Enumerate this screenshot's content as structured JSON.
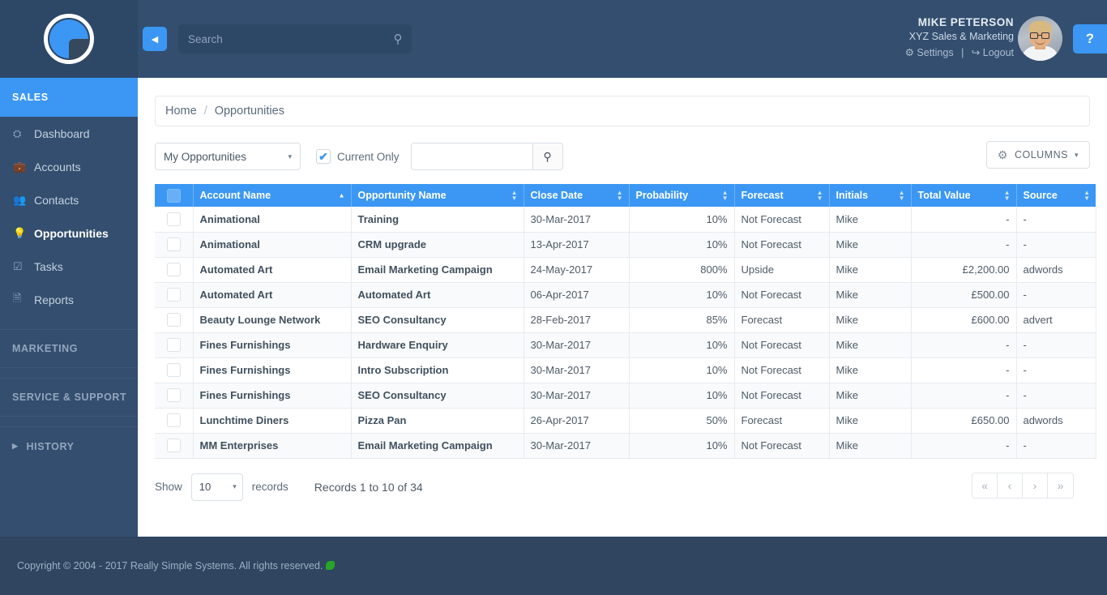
{
  "brand": {
    "accent": "#3b97f3",
    "header_bg": "#334e6f",
    "sidebar_bg": "#334e6f",
    "footer_bg": "#2f4560"
  },
  "sidebar": {
    "groups": [
      {
        "label": "SALES",
        "active": true
      },
      {
        "label": "MARKETING",
        "active": false
      },
      {
        "label": "SERVICE & SUPPORT",
        "active": false
      },
      {
        "label": "HISTORY",
        "active": false
      }
    ],
    "items": [
      {
        "label": "Dashboard",
        "icon": "dashboard-icon",
        "glyph": "⛭",
        "current": false
      },
      {
        "label": "Accounts",
        "icon": "briefcase-icon",
        "glyph": "💼",
        "current": false
      },
      {
        "label": "Contacts",
        "icon": "people-icon",
        "glyph": "👥",
        "current": false
      },
      {
        "label": "Opportunities",
        "icon": "lightbulb-icon",
        "glyph": "💡",
        "current": true
      },
      {
        "label": "Tasks",
        "icon": "check-square-icon",
        "glyph": "☑",
        "current": false
      },
      {
        "label": "Reports",
        "icon": "file-copy-icon",
        "glyph": "🗎",
        "current": false
      }
    ]
  },
  "topbar": {
    "collapse_glyph": "◀",
    "search": {
      "placeholder": "Search",
      "value": "",
      "icon": "search-icon",
      "glyph": "⚲"
    },
    "user": {
      "name": "MIKE PETERSON",
      "company": "XYZ Sales & Marketing",
      "settings_label": "Settings",
      "settings_glyph": "⚙",
      "separator": "|",
      "logout_label": "Logout",
      "logout_glyph": "↪"
    },
    "help_label": "?"
  },
  "breadcrumb": {
    "home": "Home",
    "separator": "/",
    "current": "Opportunities"
  },
  "toolbar": {
    "view_select": {
      "value": "My Opportunities",
      "caret": "▾"
    },
    "current_only": {
      "label": "Current Only",
      "checked": true,
      "check_glyph": "✔"
    },
    "filter_input": {
      "value": "",
      "placeholder": ""
    },
    "filter_button_glyph": "⚲",
    "columns_button": {
      "label": "COLUMNS",
      "gear_glyph": "⚙",
      "caret": "▾"
    }
  },
  "table": {
    "columns": [
      {
        "key": "select",
        "label": "",
        "sort": "none"
      },
      {
        "key": "account",
        "label": "Account Name",
        "sort": "asc"
      },
      {
        "key": "opportunity",
        "label": "Opportunity Name",
        "sort": "both"
      },
      {
        "key": "close_date",
        "label": "Close Date",
        "sort": "both"
      },
      {
        "key": "probability",
        "label": "Probability",
        "sort": "both"
      },
      {
        "key": "forecast",
        "label": "Forecast",
        "sort": "both"
      },
      {
        "key": "initials",
        "label": "Initials",
        "sort": "both"
      },
      {
        "key": "total_value",
        "label": "Total Value",
        "sort": "both"
      },
      {
        "key": "source",
        "label": "Source",
        "sort": "both"
      }
    ],
    "rows": [
      {
        "account": "Animational",
        "opportunity": "Training",
        "close_date": "30-Mar-2017",
        "probability": "10%",
        "forecast": "Not Forecast",
        "initials": "Mike",
        "total_value": "-",
        "source": "-"
      },
      {
        "account": "Animational",
        "opportunity": "CRM upgrade",
        "close_date": "13-Apr-2017",
        "probability": "10%",
        "forecast": "Not Forecast",
        "initials": "Mike",
        "total_value": "-",
        "source": "-"
      },
      {
        "account": "Automated Art",
        "opportunity": "Email Marketing Campaign",
        "close_date": "24-May-2017",
        "probability": "800%",
        "forecast": "Upside",
        "initials": "Mike",
        "total_value": "£2,200.00",
        "source": "adwords"
      },
      {
        "account": "Automated Art",
        "opportunity": "Automated Art",
        "close_date": "06-Apr-2017",
        "probability": "10%",
        "forecast": "Not Forecast",
        "initials": "Mike",
        "total_value": "£500.00",
        "source": "-"
      },
      {
        "account": "Beauty Lounge Network",
        "opportunity": "SEO Consultancy",
        "close_date": "28-Feb-2017",
        "probability": "85%",
        "forecast": "Forecast",
        "initials": "Mike",
        "total_value": "£600.00",
        "source": "advert"
      },
      {
        "account": "Fines Furnishings",
        "opportunity": "Hardware Enquiry",
        "close_date": "30-Mar-2017",
        "probability": "10%",
        "forecast": "Not Forecast",
        "initials": "Mike",
        "total_value": "-",
        "source": "-"
      },
      {
        "account": "Fines Furnishings",
        "opportunity": "Intro Subscription",
        "close_date": "30-Mar-2017",
        "probability": "10%",
        "forecast": "Not Forecast",
        "initials": "Mike",
        "total_value": "-",
        "source": "-"
      },
      {
        "account": "Fines Furnishings",
        "opportunity": "SEO Consultancy",
        "close_date": "30-Mar-2017",
        "probability": "10%",
        "forecast": "Not Forecast",
        "initials": "Mike",
        "total_value": "-",
        "source": "-"
      },
      {
        "account": "Lunchtime Diners",
        "opportunity": "Pizza Pan",
        "close_date": "26-Apr-2017",
        "probability": "50%",
        "forecast": "Forecast",
        "initials": "Mike",
        "total_value": "£650.00",
        "source": "adwords"
      },
      {
        "account": "MM Enterprises",
        "opportunity": "Email Marketing Campaign",
        "close_date": "30-Mar-2017",
        "probability": "10%",
        "forecast": "Not Forecast",
        "initials": "Mike",
        "total_value": "-",
        "source": "-"
      }
    ]
  },
  "pagination": {
    "show_label": "Show",
    "page_size": "10",
    "records_label": "records",
    "info": "Records 1 to 10 of 34",
    "buttons": [
      {
        "name": "first-page",
        "glyph": "«"
      },
      {
        "name": "prev-page",
        "glyph": "‹"
      },
      {
        "name": "next-page",
        "glyph": "›"
      },
      {
        "name": "last-page",
        "glyph": "»"
      }
    ]
  },
  "footer": {
    "copyright": "Copyright © 2004 - 2017 Really Simple Systems. All rights reserved."
  }
}
